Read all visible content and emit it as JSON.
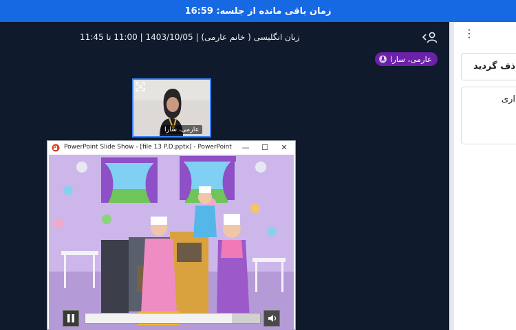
{
  "timer": {
    "text": "زمان باقی مانده از جلسه: 16:59"
  },
  "session": {
    "title": "زبان انگلیسی ( خانم عارمی) | 1403/10/05 | 11:00 تا 11:45"
  },
  "speaker": {
    "name": "عارمی، سارا"
  },
  "webcam": {
    "name": "عارمی، سارا"
  },
  "ppt": {
    "window_title": "PowerPoint Slide Show - [file 13 P.D.pptx] - PowerPoint",
    "min": "—",
    "max": "☐",
    "close": "✕",
    "progress": 0.84
  },
  "side": {
    "menu_icon": "⋮",
    "card1": "ذف گردید",
    "card2": "اری"
  },
  "colors": {
    "topbar": "#1668e3",
    "main_bg": "#0f1a2c",
    "badge": "#6b21a8",
    "cam_border": "#3b82f6"
  },
  "icons": [
    "user-switch-icon",
    "mic-icon",
    "expand-icon",
    "powerpoint-icon",
    "pause-icon",
    "volume-icon",
    "kebab-menu-icon"
  ]
}
